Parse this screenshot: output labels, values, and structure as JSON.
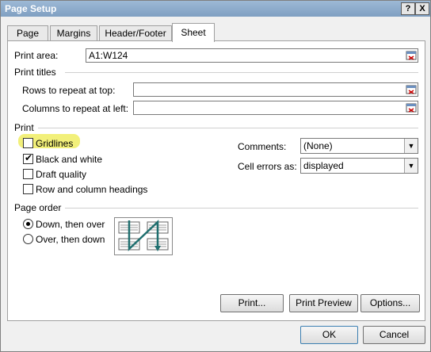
{
  "window": {
    "title": "Page Setup",
    "help_btn": "?",
    "close_btn": "X"
  },
  "tabs": [
    "Page",
    "Margins",
    "Header/Footer",
    "Sheet"
  ],
  "print_area": {
    "label": "Print area:",
    "value": "A1:W124"
  },
  "print_titles": {
    "heading": "Print titles",
    "rows_label": "Rows to repeat at top:",
    "rows_value": "",
    "cols_label": "Columns to repeat at left:",
    "cols_value": ""
  },
  "print": {
    "heading": "Print",
    "gridlines": "Gridlines",
    "black_white": "Black and white",
    "draft": "Draft quality",
    "row_col_headings": "Row and column headings",
    "gridlines_checked": false,
    "black_white_checked": true,
    "draft_checked": false,
    "row_col_headings_checked": false,
    "comments_label": "Comments:",
    "comments_value": "(None)",
    "cell_errors_label": "Cell errors as:",
    "cell_errors_value": "displayed"
  },
  "page_order": {
    "heading": "Page order",
    "down_then_over": "Down, then over",
    "over_then_down": "Over, then down",
    "selected": "down_then_over"
  },
  "buttons": {
    "print": "Print...",
    "print_preview": "Print Preview",
    "options": "Options...",
    "ok": "OK",
    "cancel": "Cancel"
  },
  "colors": {
    "highlight": "#f2f07a",
    "titlebar": "#8aa9cb"
  }
}
